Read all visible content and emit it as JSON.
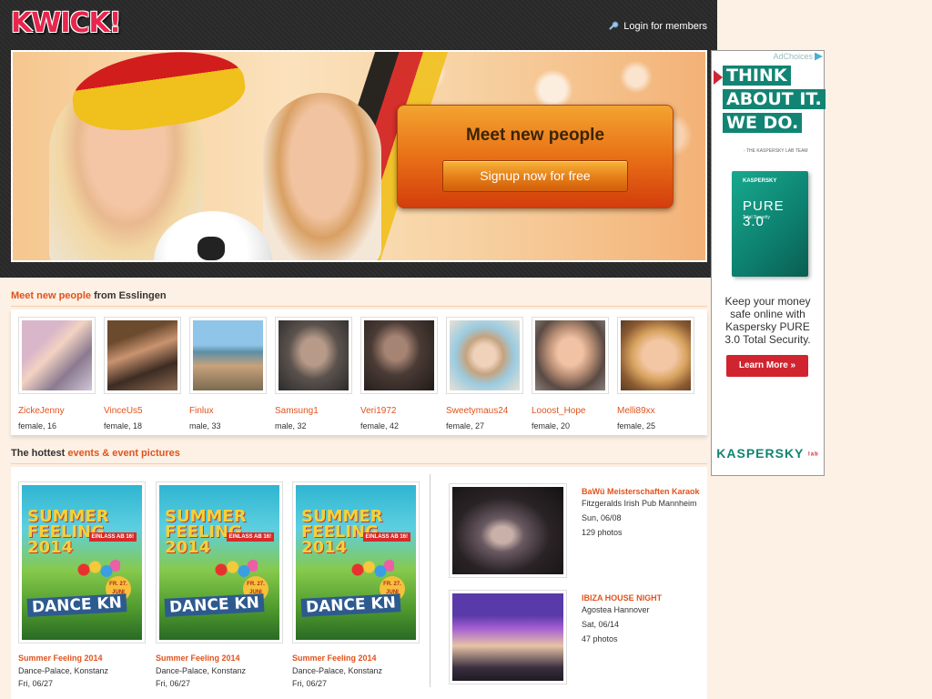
{
  "header": {
    "logo": "KWICK!",
    "login_label": "Login for members"
  },
  "hero": {
    "title": "Meet new people",
    "cta_label": "Signup now for free"
  },
  "people_section": {
    "title_highlight": "Meet new people",
    "title_rest": " from Esslingen",
    "people": [
      {
        "name": "ZickeJenny",
        "meta": "female, 16"
      },
      {
        "name": "VinceUs5",
        "meta": "female, 18"
      },
      {
        "name": "Finlux",
        "meta": "male, 33"
      },
      {
        "name": "Samsung1",
        "meta": "male, 32"
      },
      {
        "name": "Veri1972",
        "meta": "female, 42"
      },
      {
        "name": "Sweetymaus24",
        "meta": "female, 27"
      },
      {
        "name": "Looost_Hope",
        "meta": "female, 20"
      },
      {
        "name": "Melli89xx",
        "meta": "female, 25"
      }
    ]
  },
  "events_section": {
    "title_prefix": "The hottest ",
    "title_highlight": "events & event pictures",
    "events": [
      {
        "title": "Summer Feeling 2014",
        "venue": "Dance-Palace, Konstanz",
        "date": "Fri, 06/27"
      },
      {
        "title": "Summer Feeling 2014",
        "venue": "Dance-Palace, Konstanz",
        "date": "Fri, 06/27"
      },
      {
        "title": "Summer Feeling 2014",
        "venue": "Dance-Palace, Konstanz",
        "date": "Fri, 06/27"
      }
    ],
    "poster": {
      "title": "SUMMER FEELING 2014",
      "badge": "EINLASS AB 16!",
      "date": "FR. 27. JUNI",
      "dance": "DANCE KN"
    },
    "galleries": [
      {
        "title": "BaWü Meisterschaften Karaoke",
        "venue": "Fitzgeralds Irish Pub Mannheim",
        "date": "Sun, 06/08",
        "photos": "129 photos"
      },
      {
        "title": "IBIZA HOUSE NIGHT",
        "venue": "Agostea Hannover",
        "date": "Sat, 06/14",
        "photos": "47 photos"
      }
    ]
  },
  "ad": {
    "adchoices": "AdChoices",
    "headline": [
      "THINK",
      "ABOUT IT.",
      "WE DO."
    ],
    "tagline": "- THE KASPERSKY LAB TEAM",
    "product_brand": "KASPERSKY",
    "product_name": "PURE 3.0",
    "product_sub": "Total Security",
    "copy": "Keep your money safe online with Kaspersky PURE 3.0 Total Security.",
    "cta": "Learn More »",
    "logo": "KASPERSKY",
    "logo_lab": "lab"
  }
}
